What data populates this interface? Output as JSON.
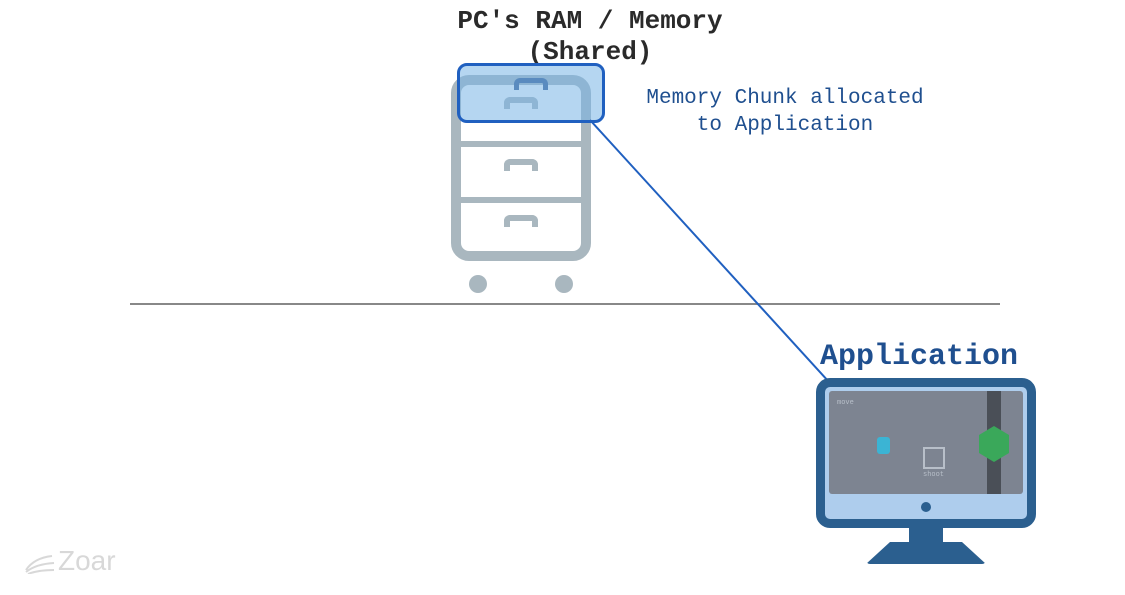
{
  "title": {
    "line1": "PC's RAM / Memory",
    "line2": "(Shared)"
  },
  "chunk_label": {
    "line1": "Memory Chunk allocated",
    "line2": "to Application"
  },
  "app_title": "Application",
  "watermark": "Zoar",
  "colors": {
    "heading": "#2a2a2a",
    "accent": "#1f4f8f",
    "cabinet": "#a9b7bf",
    "chunk_fill": "rgba(120,180,230,0.55)",
    "chunk_border": "#2060c0",
    "monitor": "#2b5f8f"
  }
}
